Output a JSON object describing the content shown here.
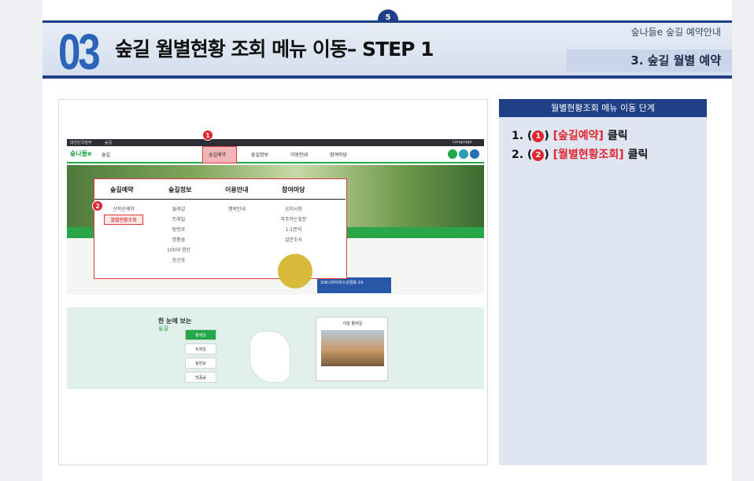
{
  "page_number": "5",
  "header": {
    "step_number": "03",
    "title": "숲길 월별현황 조회 메뉴 이동– STEP 1",
    "top_right": "숲나들e 숲길 예약안내",
    "section": "3. 숲길 월별 예약"
  },
  "panel": {
    "title": "월별현황조회 메뉴 이동 단계",
    "steps": [
      {
        "prefix": "1. (",
        "badge": "1",
        "mid": ") ",
        "target": "[숲길예약]",
        "action": " 클릭"
      },
      {
        "prefix": "2. (",
        "badge": "2",
        "mid": ") ",
        "target": "[월별현황조회]",
        "action": " 클릭"
      }
    ]
  },
  "screenshot": {
    "topbar": {
      "left1": "대한민국정부",
      "left2": "숲길",
      "right": "Language"
    },
    "logo": "숲나들e",
    "nav_left": "숲길",
    "nav": [
      "숲길예약",
      "숲길정보",
      "이용안내",
      "참여마당"
    ],
    "mega": {
      "headers": [
        "숲길예약",
        "숲길정보",
        "이용안내",
        "참여마당"
      ],
      "col1": [
        "선착순예약",
        "월별현황조회"
      ],
      "col2": [
        "둘레길",
        "트레일",
        "탐방로",
        "명품숲",
        "100대 명산",
        "등산로"
      ],
      "col3": [
        "행락안내"
      ],
      "col4": [
        "공지사항",
        "자주하는질문",
        "1:1문의",
        "설문조사"
      ]
    },
    "callouts": [
      "1",
      "2"
    ],
    "banner": "코로나바이러스감염증-19",
    "lower": {
      "heading": "한 눈에 보는",
      "subheading": "숲길",
      "buttons": [
        "둘레길",
        "트레일",
        "탐방로",
        "명품숲"
      ],
      "card_title": "이달 둘레길"
    }
  }
}
